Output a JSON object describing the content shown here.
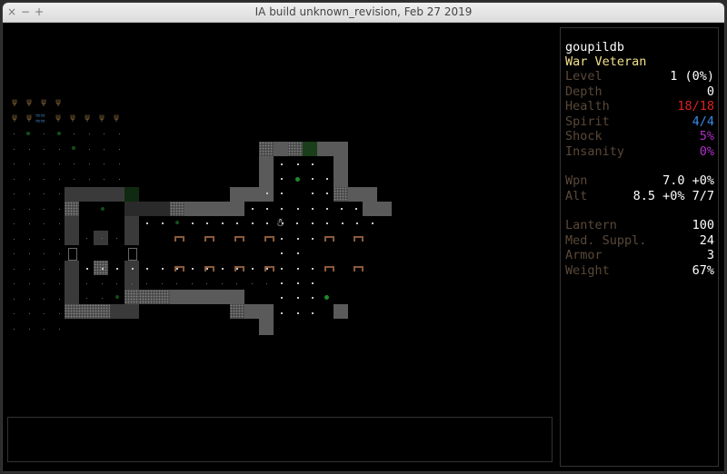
{
  "window": {
    "title": "IA build unknown_revision, Feb 27 2019",
    "buttons": {
      "close": "×",
      "minimize": "−",
      "maximize": "+"
    }
  },
  "player": {
    "glyph": "☃"
  },
  "sidebar": {
    "name": "goupildb",
    "class": "War Veteran",
    "stats": [
      {
        "label": "Level",
        "value": "1 (0%)",
        "color": "#ffffff"
      },
      {
        "label": "Depth",
        "value": "0",
        "color": "#ffffff"
      },
      {
        "label": "Health",
        "value": "18/18",
        "color": "#e02020"
      },
      {
        "label": "Spirit",
        "value": "4/4",
        "color": "#3a8ae8"
      },
      {
        "label": "Shock",
        "value": "5%",
        "color": "#b030c8"
      },
      {
        "label": "Insanity",
        "value": "0%",
        "color": "#b030c8"
      }
    ],
    "weapons": [
      {
        "label": "Wpn",
        "value": "7.0 +0%"
      },
      {
        "label": "Alt",
        "value": "8.5 +0% 7/7"
      }
    ],
    "inventory": [
      {
        "label": "Lantern",
        "value": "100"
      },
      {
        "label": "Med. Suppl.",
        "value": "24"
      },
      {
        "label": "Armor",
        "value": "3"
      },
      {
        "label": "Weight",
        "value": "67%"
      }
    ],
    "label_color": "#5a4838",
    "name_color": "#ffffff",
    "class_color": "#f2e08a"
  },
  "message_log": {
    "text": ""
  }
}
